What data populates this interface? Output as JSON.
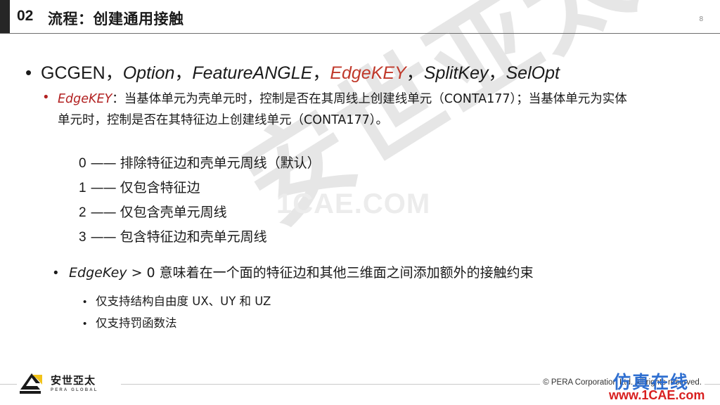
{
  "header": {
    "number": "02",
    "title": "流程：创建通用接触",
    "page_number": "8"
  },
  "content": {
    "main_bullet": {
      "bullet_glyph": "•",
      "part_1": "GCGEN",
      "sep": "，",
      "part_2": "Option",
      "part_3": "FeatureANGLE",
      "part_4_highlight": "EdgeKEY",
      "part_5": "SplitKey",
      "part_6": "SelOpt"
    },
    "sub_bullet": {
      "bullet_glyph": "•",
      "term": "EdgeKEY",
      "body": "：当基体单元为壳单元时，控制是否在其周线上创建线单元（CONTA177）；当基体单元为实体单元时，控制是否在其特征边上创建线单元（CONTA177）。"
    },
    "options": [
      {
        "value": "0",
        "dash": "——",
        "desc": "排除特征边和壳单元周线（默认）"
      },
      {
        "value": "1",
        "dash": "——",
        "desc": "仅包含特征边"
      },
      {
        "value": "2",
        "dash": "——",
        "desc": "仅包含壳单元周线"
      },
      {
        "value": "3",
        "dash": "——",
        "desc": "包含特征边和壳单元周线"
      }
    ],
    "note_bullet": {
      "bullet_glyph": "•",
      "term": "EdgeKey",
      "body": " > 0 意味着在一个面的特征边和其他三维面之间添加额外的接触约束"
    },
    "note_children": [
      {
        "bullet_glyph": "•",
        "text": "仅支持结构自由度 UX、UY 和 UZ"
      },
      {
        "bullet_glyph": "•",
        "text": "仅支持罚函数法"
      }
    ]
  },
  "watermarks": {
    "big_text": "安世亚太",
    "site_text": "1CAE.COM",
    "corner_cn": "仿真在线",
    "corner_url": "www.1CAE.com"
  },
  "footer": {
    "logo_cn": "安世亞太",
    "logo_en": "PERA GLOBAL",
    "copyright": "© PERA Corporation Ltd. All rights reserved."
  },
  "colors": {
    "accent_red": "#c0392b",
    "header_dark": "#262626",
    "logo_yellow": "#f2c31a",
    "watermark_blue": "#2f6fd0",
    "watermark_red": "#d81f1f"
  }
}
